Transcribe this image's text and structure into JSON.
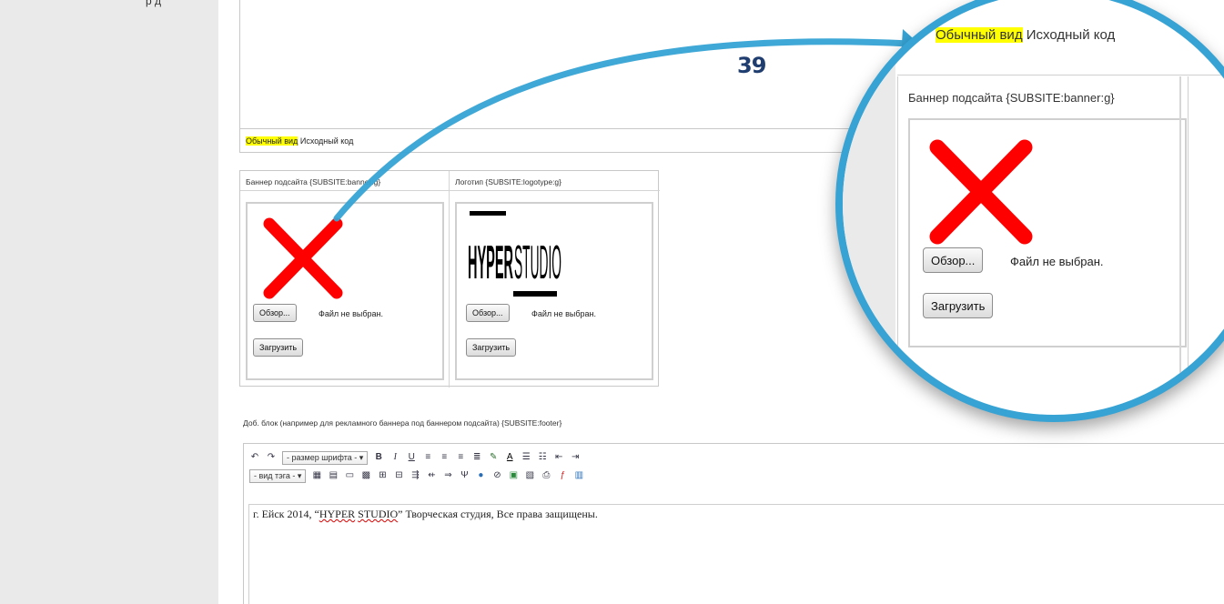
{
  "top_snippet": "р          д",
  "step_number": "39",
  "modes": {
    "normal": "Обычный вид",
    "source": "Исходный код"
  },
  "banners": [
    {
      "label": "Баннер подсайта {SUBSITE:banner:g}",
      "image_icon": "red-x-icon",
      "browse": "Обзор...",
      "no_file": "Файл не выбран.",
      "upload": "Загрузить"
    },
    {
      "label": "Логотип {SUBSITE:logotype:g}",
      "image_text": "HYPERSTUDIO",
      "browse": "Обзор...",
      "no_file": "Файл не выбран.",
      "upload": "Загрузить"
    }
  ],
  "footer": {
    "label": "Доб. блок (например для рекламного баннера под баннером подсайта) {SUBSITE:footer}",
    "font_size_select": "- размер шрифта -",
    "tag_select": "- вид тэга -",
    "content_prefix": "г. Ейск 2014, “",
    "content_w1": "HYPER",
    "content_space": " ",
    "content_w2": "STUDIO",
    "content_suffix": "” Творческая студия, Все права защищены."
  },
  "toolbar_icons_row1": [
    "undo-icon",
    "redo-icon",
    "bold-icon",
    "italic-icon",
    "underline-icon",
    "align-left-icon",
    "align-center-icon",
    "align-right-icon",
    "justify-icon",
    "highlight-icon",
    "font-color-icon",
    "bullet-list-icon",
    "numbered-list-icon",
    "outdent-icon",
    "indent-icon"
  ],
  "toolbar_icons_row2": [
    "table-icon",
    "edit-table-icon",
    "row-icon",
    "image-table-icon",
    "split-cell-icon",
    "merge-cell-icon",
    "insert-col-icon",
    "delete-col-icon",
    "insert-row-icon",
    "special-char-icon",
    "link-icon",
    "anchor-icon",
    "image-icon",
    "media-icon",
    "print-icon",
    "flash-icon",
    "save-icon"
  ],
  "colors": {
    "accent": "#36a3d4",
    "highlight": "#ffff00",
    "x_red": "#ff0000",
    "step": "#1f3d6f"
  }
}
